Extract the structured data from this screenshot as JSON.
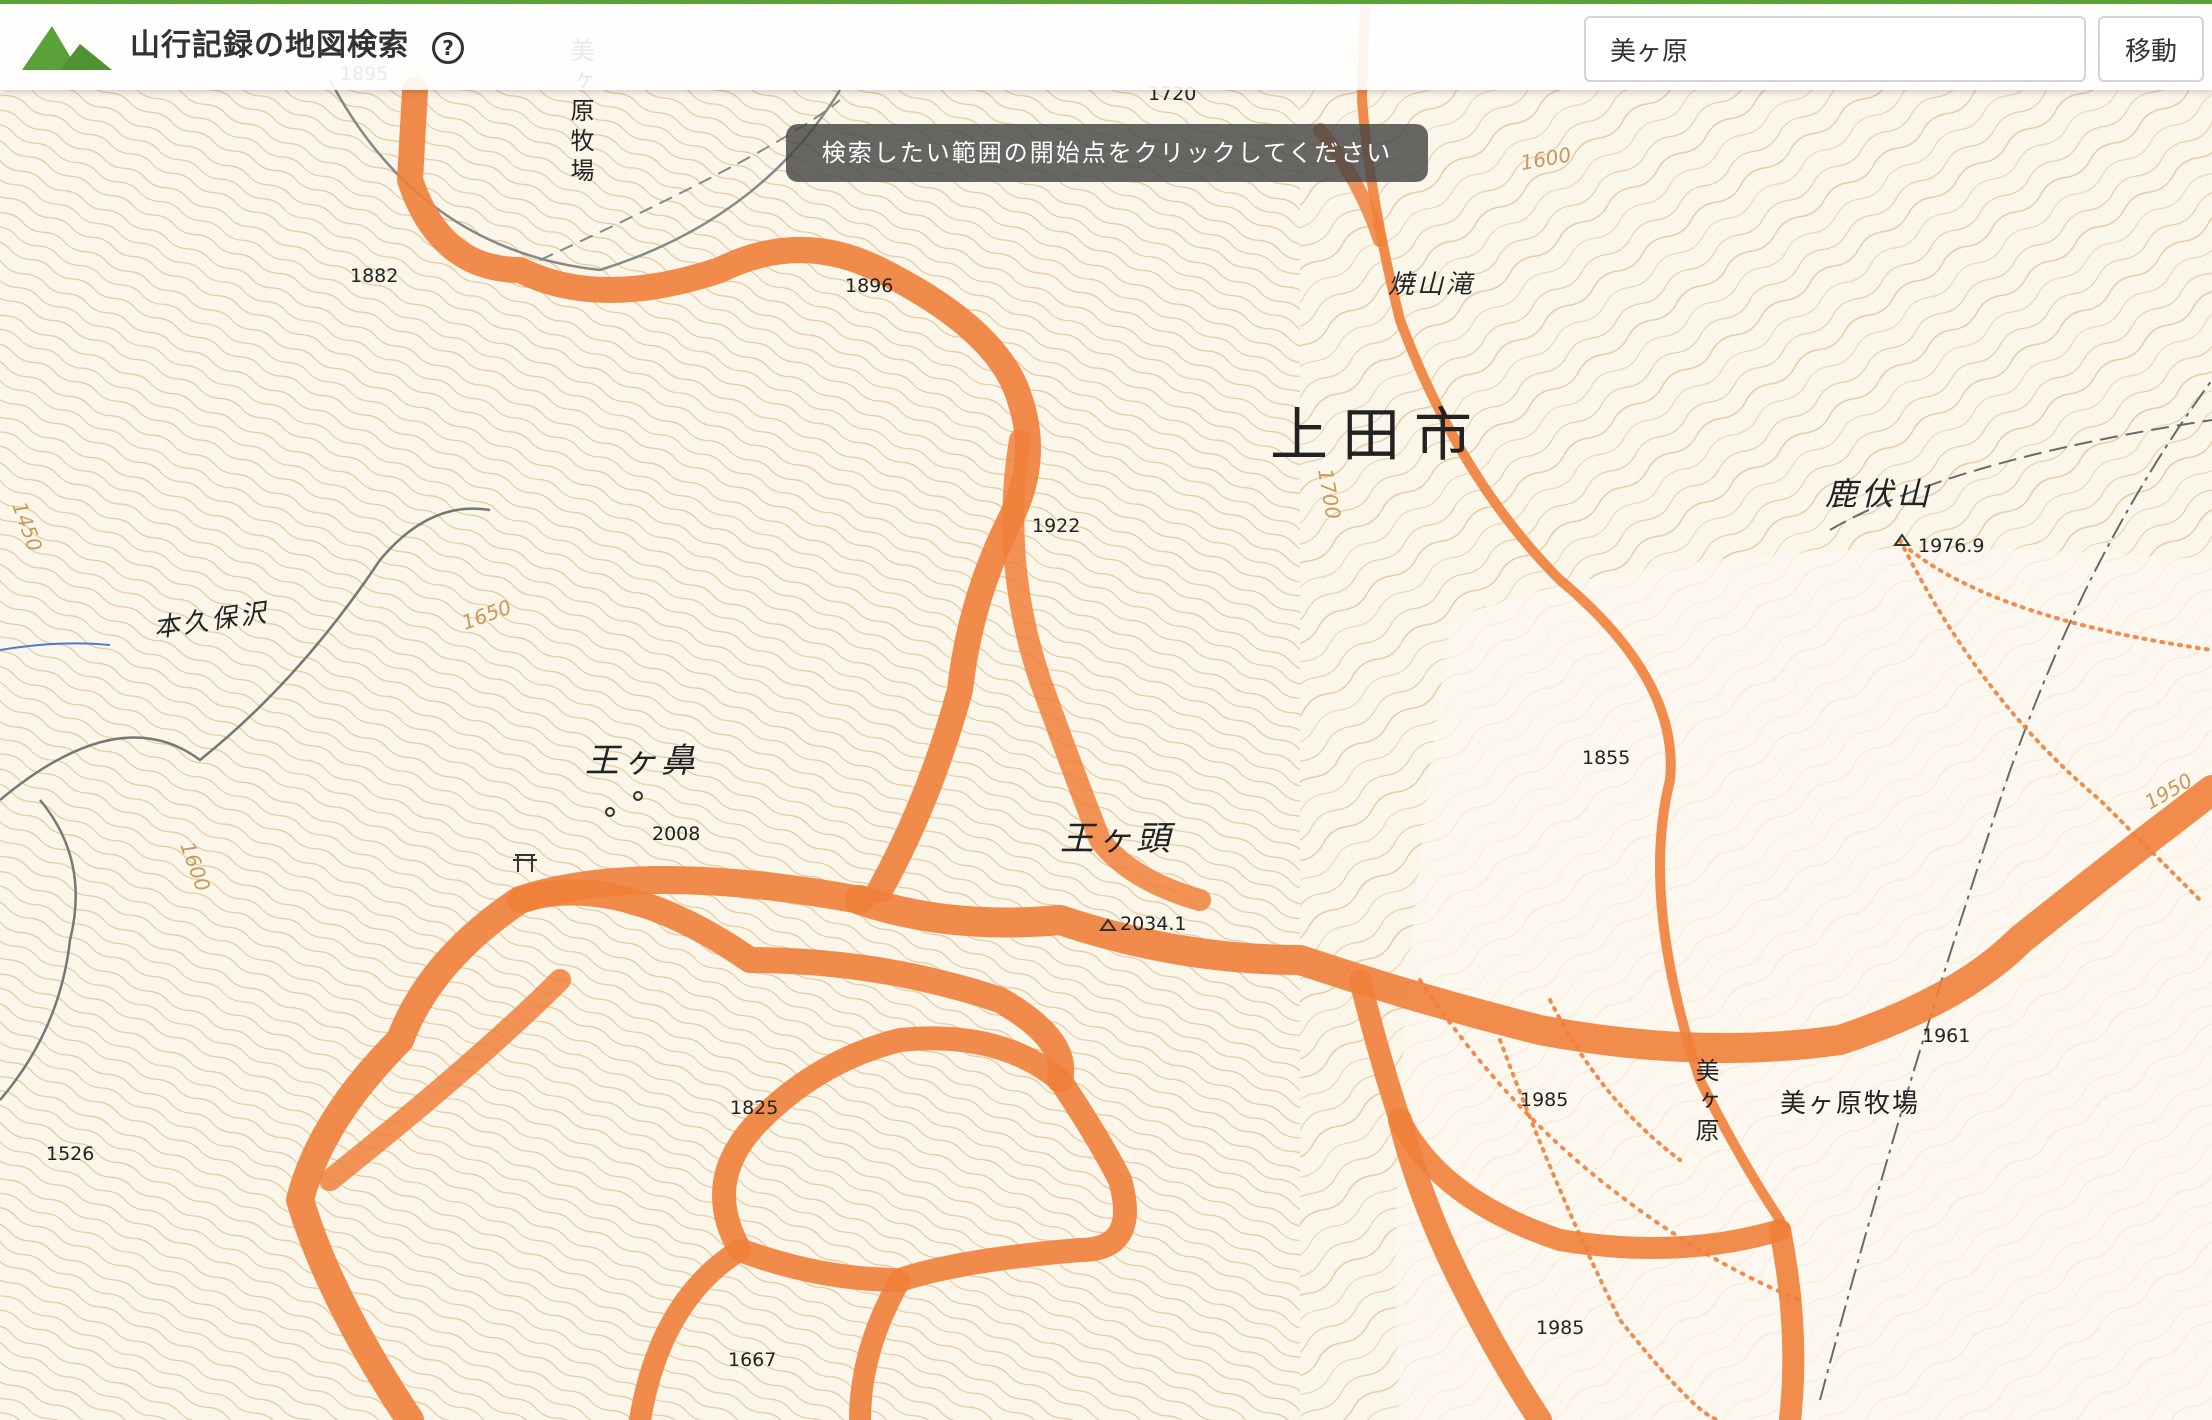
{
  "header": {
    "title": "山行記録の地図検索",
    "help_label": "?",
    "search": {
      "value": "美ヶ原",
      "placeholder": ""
    },
    "move_button_label": "移動",
    "logo_icon": "mountain-logo-icon",
    "accent_color": "#5aa13a"
  },
  "hint": {
    "text": "検索したい範囲の開始点をクリックしてください"
  },
  "map": {
    "track_color": "#f0803a",
    "labels": {
      "city": "上田市",
      "peak_okehana": "王ヶ鼻",
      "peak_oogatou": "王ヶ頭",
      "mountain_kabuseyama": "鹿伏山",
      "stream_hongubozawa": "本久保沢",
      "waterfall_yakeyama": "焼山滝",
      "ranch_top": "美ヶ原牧場",
      "ranch_right": "美ヶ原牧場",
      "area_utsukushigahara": "美ヶ原"
    },
    "elevations": {
      "e1895": "1895",
      "e1720": "1720",
      "e1882": "1882",
      "e1896": "1896",
      "e1922": "1922",
      "e1976": "1976.9",
      "e1855": "1855",
      "e2008": "2008",
      "e2034": "2034.1",
      "e1825": "1825",
      "e1985a": "1985",
      "e1985b": "1985",
      "e1961": "1961",
      "e1526": "1526",
      "e1667": "1667"
    },
    "contour_labels": {
      "c1450": "1450",
      "c1650": "1650",
      "c1600a": "1600",
      "c1600b": "1600",
      "c1700": "1700",
      "c1950": "1950"
    }
  }
}
